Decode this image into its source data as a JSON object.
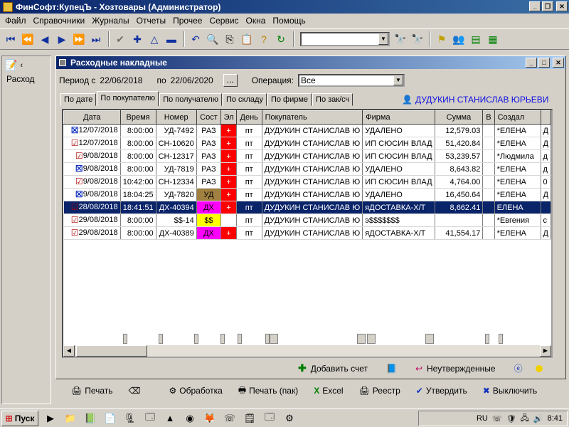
{
  "window": {
    "title": "ФинСофт:КупецЪ - Хозтовары  (Администратор)"
  },
  "menu": [
    "Файл",
    "Справочники",
    "Журналы",
    "Отчеты",
    "Прочее",
    "Сервис",
    "Окна",
    "Помощь"
  ],
  "left_panel": {
    "label": "Расход"
  },
  "doc_window": {
    "title": "Расходные накладные",
    "period_label": "Период с",
    "date_from": "22/06/2018",
    "to_label": "по",
    "date_to": "22/06/2020",
    "dots_button": "...",
    "operation_label": "Операция:",
    "operation_value": "Все",
    "tabs": [
      "По дате",
      "По покупателю",
      "По получателю",
      "По складу",
      "По фирме",
      "По зак/сч"
    ],
    "active_tab": 1,
    "customer": "ДУДУКИН СТАНИСЛАВ ЮРЬЕВИ"
  },
  "grid": {
    "columns": [
      "Дата",
      "Время",
      "Номер",
      "Сост",
      "Эл",
      "День",
      "Покупатель",
      "Фирма",
      "Сумма",
      "В",
      "Создал"
    ],
    "rows": [
      {
        "icon": "x",
        "date": "12/07/2018",
        "time": "8:00:00",
        "num": "УД-7492",
        "state": "РАЗ",
        "state_color": "#ffffff",
        "el": "+",
        "el_color": "#ff0000",
        "day": "пт",
        "buyer": "ДУДУКИН СТАНИСЛАВ Ю",
        "firm": "УДАЛЕНО",
        "sum": "12,579.03",
        "v": "",
        "creator": "*ЕЛЕНА",
        "extra": "Д"
      },
      {
        "icon": "ok",
        "date": "12/07/2018",
        "time": "8:00:00",
        "num": "СН-10620",
        "state": "РАЗ",
        "state_color": "#ffffff",
        "el": "+",
        "el_color": "#ff0000",
        "day": "пт",
        "buyer": "ДУДУКИН СТАНИСЛАВ Ю",
        "firm": "ИП СЮСИН ВЛАД",
        "sum": "51,420.84",
        "v": "",
        "creator": "*ЕЛЕНА",
        "extra": "Д"
      },
      {
        "icon": "ok",
        "date": "9/08/2018",
        "time": "8:00:00",
        "num": "СН-12317",
        "state": "РАЗ",
        "state_color": "#ffffff",
        "el": "+",
        "el_color": "#ff0000",
        "day": "пт",
        "buyer": "ДУДУКИН СТАНИСЛАВ Ю",
        "firm": "ИП СЮСИН ВЛАД",
        "sum": "53,239.57",
        "v": "",
        "creator": "*Людмила",
        "extra": "д"
      },
      {
        "icon": "x",
        "date": "9/08/2018",
        "time": "8:00:00",
        "num": "УД-7819",
        "state": "РАЗ",
        "state_color": "#ffffff",
        "el": "+",
        "el_color": "#ff0000",
        "day": "пт",
        "buyer": "ДУДУКИН СТАНИСЛАВ Ю",
        "firm": "УДАЛЕНО",
        "sum": "8,643.82",
        "v": "",
        "creator": "*ЕЛЕНА",
        "extra": "д"
      },
      {
        "icon": "ok",
        "date": "9/08/2018",
        "time": "10:42:00",
        "num": "СН-12334",
        "state": "РАЗ",
        "state_color": "#ffffff",
        "el": "+",
        "el_color": "#ff0000",
        "day": "пт",
        "buyer": "ДУДУКИН СТАНИСЛАВ Ю",
        "firm": "ИП СЮСИН ВЛАД",
        "sum": "4,764.00",
        "v": "",
        "creator": "*ЕЛЕНА",
        "extra": "0"
      },
      {
        "icon": "x",
        "date": "9/08/2018",
        "time": "18:04:25",
        "num": "УД-7820",
        "state": "УД",
        "state_color": "#a08040",
        "el": "+",
        "el_color": "#ff0000",
        "day": "пт",
        "buyer": "ДУДУКИН СТАНИСЛАВ Ю",
        "firm": "УДАЛЕНО",
        "sum": "16,450.64",
        "v": "",
        "creator": "*ЕЛЕНА",
        "extra": "Д"
      },
      {
        "icon": "ok",
        "date": "28/08/2018",
        "time": "18:41:51",
        "num": "ДХ-40394",
        "state": "ДХ",
        "state_color": "#ff00ff",
        "el": "+",
        "el_color": "#ff0000",
        "day": "пт",
        "buyer": "ДУДУКИН СТАНИСЛАВ Ю",
        "firm": "яДОСТАВКА-Х/Т",
        "sum": "8,662.41",
        "v": "",
        "creator": "ЕЛЕНА",
        "extra": "",
        "selected": true
      },
      {
        "icon": "ok",
        "date": "29/08/2018",
        "time": "8:00:00",
        "num": "$$-14",
        "state": "$$",
        "state_color": "#ffff00",
        "el": "",
        "el_color": "#ffffff",
        "day": "пт",
        "buyer": "ДУДУКИН СТАНИСЛАВ Ю",
        "firm": "э$$$$$$$",
        "sum": "",
        "v": "",
        "creator": "*Евгения",
        "extra": "с"
      },
      {
        "icon": "ok",
        "date": "29/08/2018",
        "time": "8:00:00",
        "num": "ДХ-40389",
        "state": "ДХ",
        "state_color": "#ff00ff",
        "el": "+",
        "el_color": "#ff0000",
        "day": "пт",
        "buyer": "ДУДУКИН СТАНИСЛАВ Ю",
        "firm": "яДОСТАВКА-Х/Т",
        "sum": "41,554.17",
        "v": "",
        "creator": "*ЕЛЕНА",
        "extra": "Д"
      }
    ]
  },
  "bottom_actions": {
    "add_invoice": "Добавить счет",
    "unconfirmed": "Неутвержденные"
  },
  "footer": [
    "Печать",
    "Обработка",
    "Печать (пак)",
    "Excel",
    "Реестр",
    "Утвердить",
    "Выключить"
  ],
  "taskbar": {
    "start": "Пуск",
    "lang": "RU",
    "time": "8:41"
  }
}
